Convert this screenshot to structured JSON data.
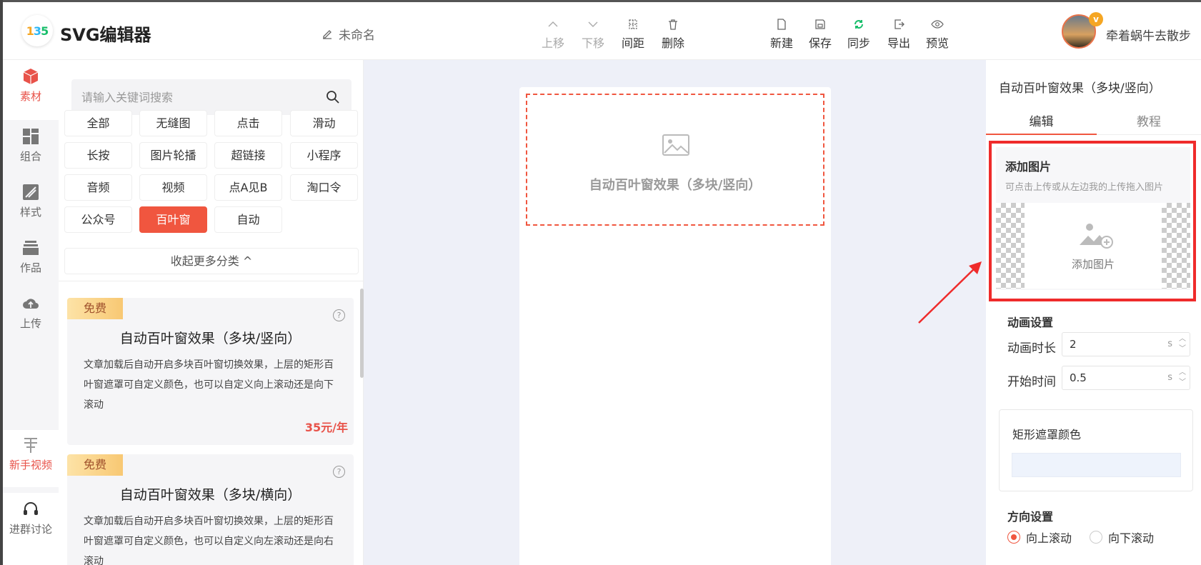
{
  "app": {
    "name": "SVG编辑器",
    "logo_text": "135"
  },
  "document": {
    "name": "未命名"
  },
  "toolbar": {
    "move_up": "上移",
    "move_down": "下移",
    "spacing": "间距",
    "delete": "删除",
    "new": "新建",
    "save": "保存",
    "sync": "同步",
    "export": "导出",
    "preview": "预览"
  },
  "user": {
    "name": "牵着蜗牛去散步",
    "vip_badge": "v"
  },
  "rail": [
    {
      "label": "素材",
      "icon": "cube-icon"
    },
    {
      "label": "组合",
      "icon": "grid-icon"
    },
    {
      "label": "样式",
      "icon": "style-icon"
    },
    {
      "label": "作品",
      "icon": "layers-icon"
    },
    {
      "label": "上传",
      "icon": "cloud-upload-icon"
    },
    {
      "label": "新手视频",
      "icon": "video-icon"
    },
    {
      "label": "进群讨论",
      "icon": "headset-icon"
    }
  ],
  "search": {
    "placeholder": "请输入关键词搜索"
  },
  "categories": [
    "全部",
    "无缝图",
    "点击",
    "滑动",
    "长按",
    "图片轮播",
    "超链接",
    "小程序",
    "音频",
    "视频",
    "点A见B",
    "淘口令",
    "公众号",
    "百叶窗",
    "自动"
  ],
  "active_category": "百叶窗",
  "collapse_label": "收起更多分类 ^",
  "cards": [
    {
      "badge": "免费",
      "title": "自动百叶窗效果（多块/竖向）",
      "desc": "文章加载后自动开启多块百叶窗切换效果，上层的矩形百叶窗遮罩可自定义颜色，也可以自定义向上滚动还是向下滚动",
      "price": "35元/年"
    },
    {
      "badge": "免费",
      "title": "自动百叶窗效果（多块/横向）",
      "desc": "文章加载后自动开启多块百叶窗切换效果，上层的矩形百叶窗遮罩可自定义颜色，也可以自定义向左滚动还是向右滚动"
    }
  ],
  "canvas": {
    "block_title": "自动百叶窗效果（多块/竖向）"
  },
  "inspector": {
    "title": "自动百叶窗效果（多块/竖向）",
    "tabs": [
      "编辑",
      "教程"
    ],
    "add_image": {
      "title": "添加图片",
      "tip": "可点击上传或从左边我的上传拖入图片",
      "button": "添加图片"
    },
    "animation": {
      "title": "动画设置",
      "duration_label": "动画时长",
      "duration_value": "2",
      "duration_unit": "s",
      "start_label": "开始时间",
      "start_value": "0.5",
      "start_unit": "s"
    },
    "mask_color": {
      "label": "矩形遮罩颜色",
      "value": "#eef3fc"
    },
    "direction": {
      "title": "方向设置",
      "options": [
        "向上滚动",
        "向下滚动"
      ],
      "selected": "向上滚动"
    }
  },
  "colors": {
    "accent": "#f0563f",
    "highlight": "#ef2b2b",
    "canvas_bg": "#eef0f8"
  }
}
